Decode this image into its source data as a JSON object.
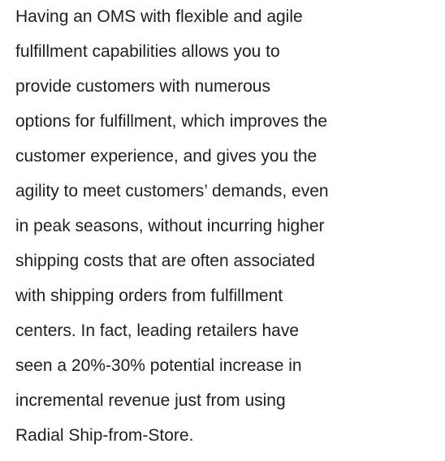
{
  "paragraph": {
    "lines": [
      "Having an OMS with flexible and agile",
      "fulfillment capabilities allows you to",
      "provide customers with numerous",
      "options for fulfillment, which improves the",
      "customer experience, and gives you the",
      "agility to meet customers’ demands, even",
      "in peak seasons, without incurring higher",
      "shipping costs that are often associated",
      "with shipping orders from fulfillment",
      "centers. In fact, leading retailers have",
      "seen a 20%-30% potential increase in",
      "incremental revenue just from using",
      "Radial Ship-from-Store."
    ]
  }
}
